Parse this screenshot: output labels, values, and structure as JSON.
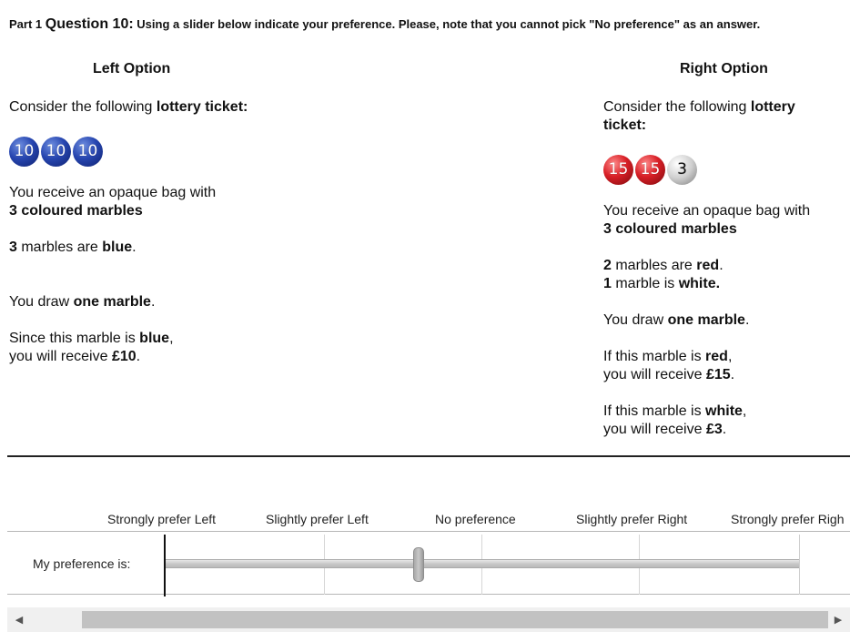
{
  "header": {
    "part": "Part 1",
    "question": "Question 10:",
    "instruction": " Using a slider below indicate your preference. Please, note that you cannot pick \"No preference\" as an answer."
  },
  "left_option": {
    "title": "Left Option",
    "intro": "Consider the following ",
    "intro_bold": "lottery ticket:",
    "balls": [
      {
        "label": "10",
        "color": "blue"
      },
      {
        "label": "10",
        "color": "blue"
      },
      {
        "label": "10",
        "color": "blue"
      }
    ],
    "bag_line1": "You receive an opaque bag with",
    "bag_line2": "3 coloured marbles",
    "m1_count": "3",
    "m1_text": " marbles are ",
    "m1_color": "blue",
    "m1_end": ".",
    "draw_pre": "You draw ",
    "draw_bold": "one marble",
    "draw_end": ".",
    "p1_pre": "Since this marble is ",
    "p1_color": "blue",
    "p1_mid": ",",
    "p1_line2_pre": "you will receive ",
    "p1_amount": "£10",
    "p1_end": "."
  },
  "right_option": {
    "title": "Right Option",
    "intro": "Consider the following ",
    "intro_bold1": "lottery",
    "intro_bold2": "ticket:",
    "balls": [
      {
        "label": "15",
        "color": "red"
      },
      {
        "label": "15",
        "color": "red"
      },
      {
        "label": "3",
        "color": "white"
      }
    ],
    "bag_line1": "You receive an opaque bag with",
    "bag_line2": "3 coloured marbles",
    "m1_count": "2",
    "m1_text": " marbles are ",
    "m1_color": "red",
    "m1_end": ".",
    "m2_count": "1",
    "m2_text": " marble is ",
    "m2_color": "white.",
    "draw_pre": "You draw ",
    "draw_bold": "one marble",
    "draw_end": ".",
    "p1_pre": "If this marble is ",
    "p1_color": "red",
    "p1_mid": ",",
    "p1_line2_pre": "you will receive ",
    "p1_amount": "£15",
    "p1_end": ".",
    "p2_pre": "If this marble is ",
    "p2_color": "white",
    "p2_mid": ",",
    "p2_line2_pre": "you will receive ",
    "p2_amount": "£3",
    "p2_end": "."
  },
  "scale": {
    "labels": [
      "Strongly prefer Left",
      "Slightly prefer Left",
      "No preference",
      "Slightly prefer Right",
      "Strongly prefer Righ"
    ]
  },
  "slider": {
    "row_label": "My preference is:",
    "value_fraction": 0.4
  },
  "scrollbar": {
    "left_arrow": "◀",
    "right_arrow": "▶"
  }
}
